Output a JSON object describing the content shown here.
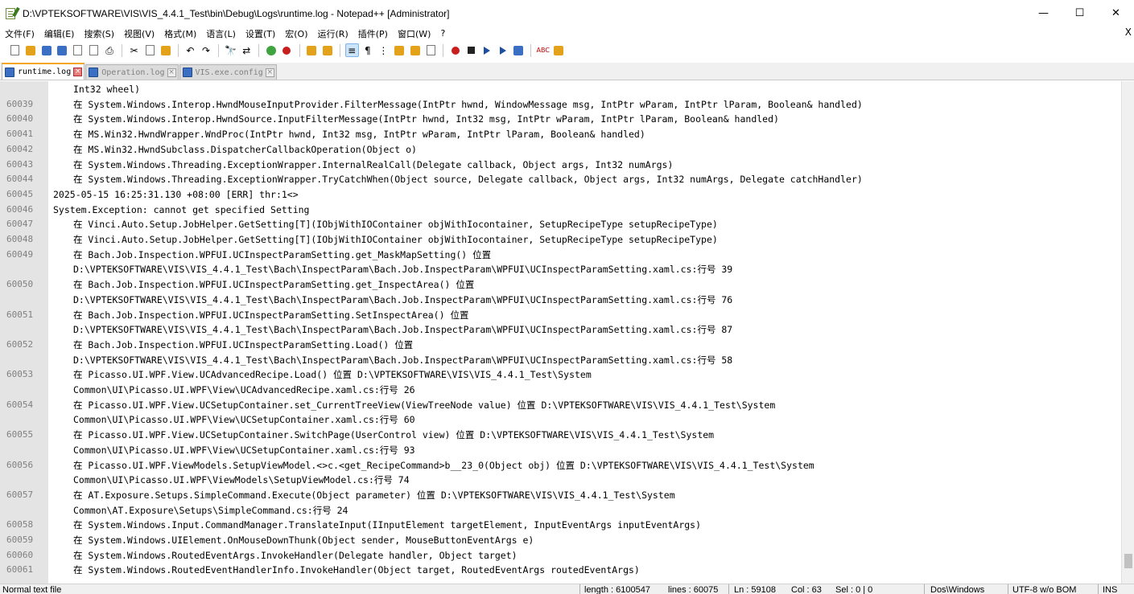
{
  "window": {
    "title": "D:\\VPTEKSOFTWARE\\VIS\\VIS_4.4.1_Test\\bin\\Debug\\Logs\\runtime.log - Notepad++ [Administrator]",
    "minimize": "—",
    "maximize": "☐",
    "close": "✕"
  },
  "menu": {
    "items": [
      "文件(F)",
      "编辑(E)",
      "搜索(S)",
      "视图(V)",
      "格式(M)",
      "语言(L)",
      "设置(T)",
      "宏(O)",
      "运行(R)",
      "插件(P)",
      "窗口(W)",
      "?"
    ],
    "close": "X"
  },
  "tabs": [
    {
      "label": "runtime.log",
      "active": true
    },
    {
      "label": "Operation.log",
      "active": false
    },
    {
      "label": "VIS.exe.config",
      "active": false
    }
  ],
  "editor": {
    "lines": [
      {
        "n": "",
        "cont": true,
        "text": "Int32 wheel)"
      },
      {
        "n": "60039",
        "cont": true,
        "text": "在 System.Windows.Interop.HwndMouseInputProvider.FilterMessage(IntPtr hwnd, WindowMessage msg, IntPtr wParam, IntPtr lParam, Boolean& handled)"
      },
      {
        "n": "60040",
        "cont": true,
        "text": "在 System.Windows.Interop.HwndSource.InputFilterMessage(IntPtr hwnd, Int32 msg, IntPtr wParam, IntPtr lParam, Boolean& handled)"
      },
      {
        "n": "60041",
        "cont": true,
        "text": "在 MS.Win32.HwndWrapper.WndProc(IntPtr hwnd, Int32 msg, IntPtr wParam, IntPtr lParam, Boolean& handled)"
      },
      {
        "n": "60042",
        "cont": true,
        "text": "在 MS.Win32.HwndSubclass.DispatcherCallbackOperation(Object o)"
      },
      {
        "n": "60043",
        "cont": true,
        "text": "在 System.Windows.Threading.ExceptionWrapper.InternalRealCall(Delegate callback, Object args, Int32 numArgs)"
      },
      {
        "n": "60044",
        "cont": true,
        "text": "在 System.Windows.Threading.ExceptionWrapper.TryCatchWhen(Object source, Delegate callback, Object args, Int32 numArgs, Delegate catchHandler)"
      },
      {
        "n": "60045",
        "cont": false,
        "text": "2025-05-15 16:25:31.130 +08:00 [ERR] thr:1<>"
      },
      {
        "n": "60046",
        "cont": false,
        "text": "System.Exception: cannot get specified Setting"
      },
      {
        "n": "60047",
        "cont": true,
        "text": "在 Vinci.Auto.Setup.JobHelper.GetSetting[T](IObjWithIOContainer objWithIocontainer, SetupRecipeType setupRecipeType)"
      },
      {
        "n": "60048",
        "cont": true,
        "text": "在 Vinci.Auto.Setup.JobHelper.GetSetting[T](IObjWithIOContainer objWithIocontainer, SetupRecipeType setupRecipeType)"
      },
      {
        "n": "60049",
        "cont": true,
        "text": "在 Bach.Job.Inspection.WPFUI.UCInspectParamSetting.get_MaskMapSetting() 位置"
      },
      {
        "n": "",
        "cont": true,
        "text": "D:\\VPTEKSOFTWARE\\VIS\\VIS_4.4.1_Test\\Bach\\InspectParam\\Bach.Job.InspectParam\\WPFUI\\UCInspectParamSetting.xaml.cs:行号 39"
      },
      {
        "n": "60050",
        "cont": true,
        "text": "在 Bach.Job.Inspection.WPFUI.UCInspectParamSetting.get_InspectArea() 位置"
      },
      {
        "n": "",
        "cont": true,
        "text": "D:\\VPTEKSOFTWARE\\VIS\\VIS_4.4.1_Test\\Bach\\InspectParam\\Bach.Job.InspectParam\\WPFUI\\UCInspectParamSetting.xaml.cs:行号 76"
      },
      {
        "n": "60051",
        "cont": true,
        "text": "在 Bach.Job.Inspection.WPFUI.UCInspectParamSetting.SetInspectArea() 位置"
      },
      {
        "n": "",
        "cont": true,
        "text": "D:\\VPTEKSOFTWARE\\VIS\\VIS_4.4.1_Test\\Bach\\InspectParam\\Bach.Job.InspectParam\\WPFUI\\UCInspectParamSetting.xaml.cs:行号 87"
      },
      {
        "n": "60052",
        "cont": true,
        "text": "在 Bach.Job.Inspection.WPFUI.UCInspectParamSetting.Load() 位置"
      },
      {
        "n": "",
        "cont": true,
        "text": "D:\\VPTEKSOFTWARE\\VIS\\VIS_4.4.1_Test\\Bach\\InspectParam\\Bach.Job.InspectParam\\WPFUI\\UCInspectParamSetting.xaml.cs:行号 58"
      },
      {
        "n": "60053",
        "cont": true,
        "text": "在 Picasso.UI.WPF.View.UCAdvancedRecipe.Load() 位置 D:\\VPTEKSOFTWARE\\VIS\\VIS_4.4.1_Test\\System"
      },
      {
        "n": "",
        "cont": true,
        "text": "Common\\UI\\Picasso.UI.WPF\\View\\UCAdvancedRecipe.xaml.cs:行号 26"
      },
      {
        "n": "60054",
        "cont": true,
        "text": "在 Picasso.UI.WPF.View.UCSetupContainer.set_CurrentTreeView(ViewTreeNode value) 位置 D:\\VPTEKSOFTWARE\\VIS\\VIS_4.4.1_Test\\System"
      },
      {
        "n": "",
        "cont": true,
        "text": "Common\\UI\\Picasso.UI.WPF\\View\\UCSetupContainer.xaml.cs:行号 60"
      },
      {
        "n": "60055",
        "cont": true,
        "text": "在 Picasso.UI.WPF.View.UCSetupContainer.SwitchPage(UserControl view) 位置 D:\\VPTEKSOFTWARE\\VIS\\VIS_4.4.1_Test\\System"
      },
      {
        "n": "",
        "cont": true,
        "text": "Common\\UI\\Picasso.UI.WPF\\View\\UCSetupContainer.xaml.cs:行号 93"
      },
      {
        "n": "60056",
        "cont": true,
        "text": "在 Picasso.UI.WPF.ViewModels.SetupViewModel.<>c.<get_RecipeCommand>b__23_0(Object obj) 位置 D:\\VPTEKSOFTWARE\\VIS\\VIS_4.4.1_Test\\System"
      },
      {
        "n": "",
        "cont": true,
        "text": "Common\\UI\\Picasso.UI.WPF\\ViewModels\\SetupViewModel.cs:行号 74"
      },
      {
        "n": "60057",
        "cont": true,
        "text": "在 AT.Exposure.Setups.SimpleCommand.Execute(Object parameter) 位置 D:\\VPTEKSOFTWARE\\VIS\\VIS_4.4.1_Test\\System"
      },
      {
        "n": "",
        "cont": true,
        "text": "Common\\AT.Exposure\\Setups\\SimpleCommand.cs:行号 24"
      },
      {
        "n": "60058",
        "cont": true,
        "text": "在 System.Windows.Input.CommandManager.TranslateInput(IInputElement targetElement, InputEventArgs inputEventArgs)"
      },
      {
        "n": "60059",
        "cont": true,
        "text": "在 System.Windows.UIElement.OnMouseDownThunk(Object sender, MouseButtonEventArgs e)"
      },
      {
        "n": "60060",
        "cont": true,
        "text": "在 System.Windows.RoutedEventArgs.InvokeHandler(Delegate handler, Object target)"
      },
      {
        "n": "60061",
        "cont": true,
        "text": "在 System.Windows.RoutedEventHandlerInfo.InvokeHandler(Object target, RoutedEventArgs routedEventArgs)"
      }
    ]
  },
  "status": {
    "file_type": "Normal text file",
    "length": "length : 6100547",
    "lines": "lines : 60075",
    "ln": "Ln : 59108",
    "col": "Col : 63",
    "sel": "Sel : 0 | 0",
    "eol": "Dos\\Windows",
    "encoding": "UTF-8 w/o BOM",
    "mode": "INS"
  }
}
